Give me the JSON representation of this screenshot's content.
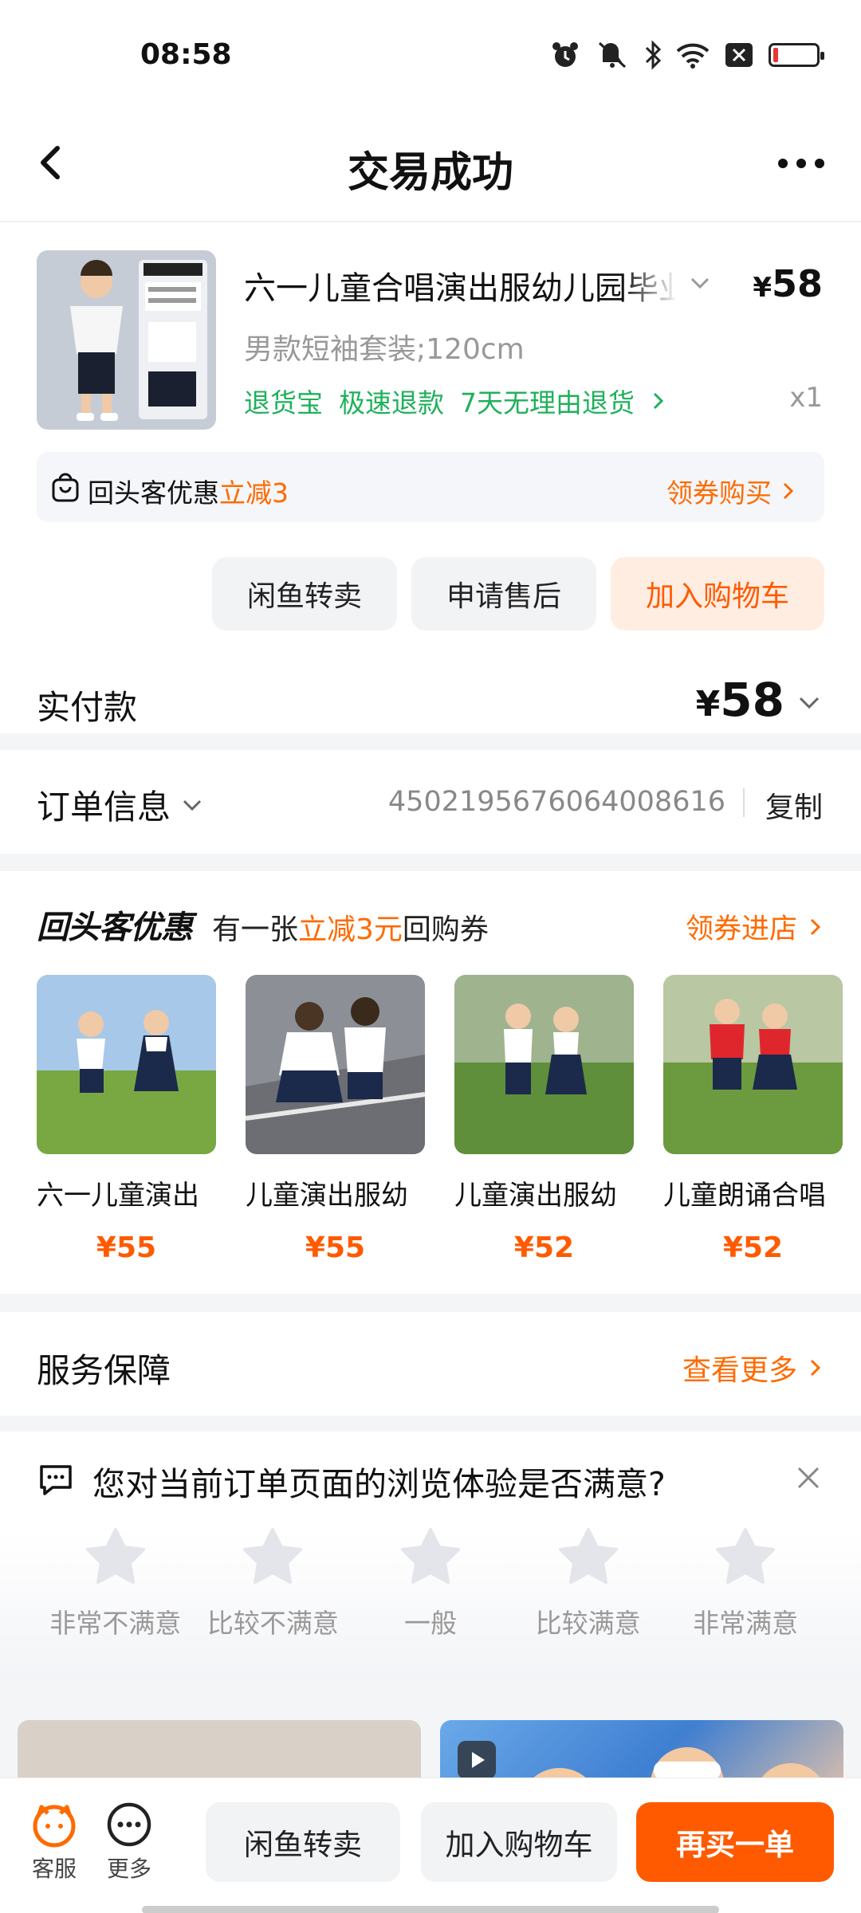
{
  "status": {
    "time": "08:58"
  },
  "header": {
    "title": "交易成功"
  },
  "product": {
    "title": "六一儿童合唱演出服幼儿园毕业",
    "price_symbol": "¥",
    "price": "58",
    "spec": "男款短袖套装;120cm",
    "tags": [
      "退货宝",
      "极速退款",
      "7天无理由退货"
    ],
    "quantity": "x1",
    "coupon_text": "回头客优惠",
    "coupon_highlight": "立减3",
    "coupon_action": "领券购买",
    "actions": [
      "闲鱼转卖",
      "申请售后",
      "加入购物车"
    ]
  },
  "payment": {
    "label": "实付款",
    "symbol": "¥",
    "amount": "58"
  },
  "order": {
    "label": "订单信息",
    "number": "4502195676064008616",
    "copy": "复制"
  },
  "rebuy": {
    "logo": "回头客优惠",
    "desc_prefix": "有一张",
    "desc_highlight": "立减3元",
    "desc_suffix": "回购券",
    "action": "领券进店",
    "items": [
      {
        "name": "六一儿童演出",
        "price": "¥55"
      },
      {
        "name": "儿童演出服幼",
        "price": "¥55"
      },
      {
        "name": "儿童演出服幼",
        "price": "¥52"
      },
      {
        "name": "儿童朗诵合唱",
        "price": "¥52"
      }
    ]
  },
  "service": {
    "label": "服务保障",
    "action": "查看更多"
  },
  "survey": {
    "question": "您对当前订单页面的浏览体验是否满意?",
    "ratings": [
      "非常不满意",
      "比较不满意",
      "一般",
      "比较满意",
      "非常满意"
    ]
  },
  "bottom": {
    "service_label": "客服",
    "more_label": "更多",
    "resell": "闲鱼转卖",
    "add_cart": "加入购物车",
    "buy_again": "再买一单"
  },
  "colors": {
    "accent": "#ff5a00",
    "green": "#1fb15b"
  }
}
